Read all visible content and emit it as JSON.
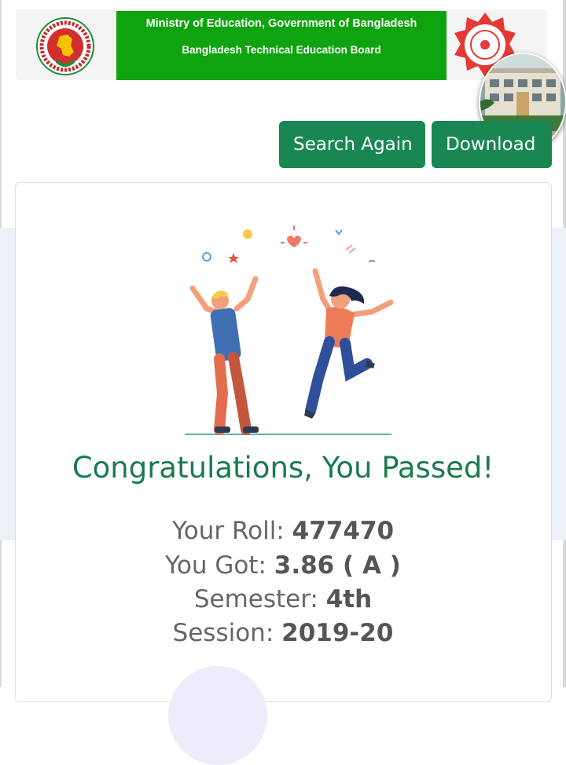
{
  "header": {
    "line1": "Ministry of Education, Government of Bangladesh",
    "line2": "Bangladesh Technical Education Board",
    "left_logo": "bangladesh-govt-seal-icon",
    "right_logo": "btEB-seal-icon",
    "banner_color": "#10a310"
  },
  "actions": {
    "search_again": "Search Again",
    "download": "Download"
  },
  "result": {
    "message": "Congratulations, You Passed!",
    "roll_label": "Your Roll:",
    "roll": "477470",
    "gpa_label": "You Got:",
    "gpa": "3.86 ( A )",
    "semester_label": "Semester:",
    "semester": "4th",
    "session_label": "Session:",
    "session": "2019-20"
  },
  "colors": {
    "accent": "#198754",
    "congrats_text": "#1b7a4f"
  }
}
